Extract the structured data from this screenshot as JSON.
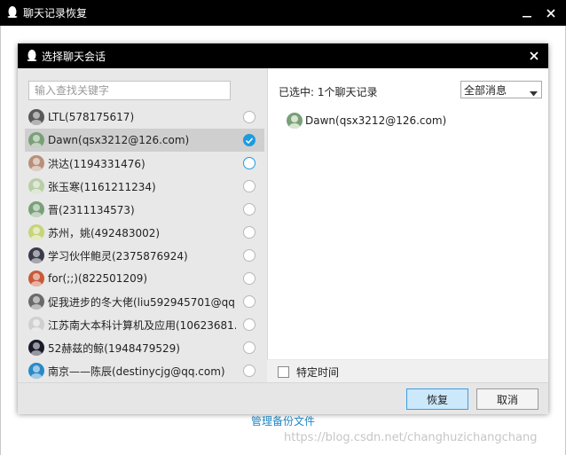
{
  "outer": {
    "title": "聊天记录恢复",
    "manage_link": "管理备份文件",
    "watermark": "https://blog.csdn.net/changhuzichangchang"
  },
  "dialog": {
    "title": "选择聊天会话",
    "search_placeholder": "输入查找关键字",
    "selected_count": "已选中: 1个聊天记录",
    "filter_value": "全部消息",
    "selected_item": "Dawn(qsx3212@126.com)",
    "specific_time": "特定时间",
    "ok_label": "恢复",
    "cancel_label": "取消"
  },
  "contacts": [
    {
      "name": "LTL(578175617)",
      "state": "none",
      "avatar_color": "#5a5a5a"
    },
    {
      "name": "Dawn(qsx3212@126.com)",
      "state": "checked",
      "avatar_color": "#7aa07a"
    },
    {
      "name": "洪达(1194331476)",
      "state": "hover",
      "avatar_color": "#b8907a"
    },
    {
      "name": "张玉寒(1161211234)",
      "state": "none",
      "avatar_color": "#b9cfa6"
    },
    {
      "name": "晋(2311134573)",
      "state": "none",
      "avatar_color": "#7aa07a"
    },
    {
      "name": "苏州，姚(492483002)",
      "state": "none",
      "avatar_color": "#c8d37a"
    },
    {
      "name": "学习伙伴鲍灵(2375876924)",
      "state": "none",
      "avatar_color": "#3a3a4a"
    },
    {
      "name": "for(;;)(822501209)",
      "state": "none",
      "avatar_color": "#c85a3a"
    },
    {
      "name": "促我进步的冬大佬(liu592945701@qq....",
      "state": "none",
      "avatar_color": "#6a6a6a"
    },
    {
      "name": "江苏南大本科计算机及应用(10623681...",
      "state": "none",
      "avatar_color": "#d0d0d0"
    },
    {
      "name": "52赫兹的鲸(1948479529)",
      "state": "none",
      "avatar_color": "#1a1a2a"
    },
    {
      "name": "南京——陈辰(destinycjg@qq.com)",
      "state": "none",
      "avatar_color": "#2a8ac8"
    }
  ]
}
